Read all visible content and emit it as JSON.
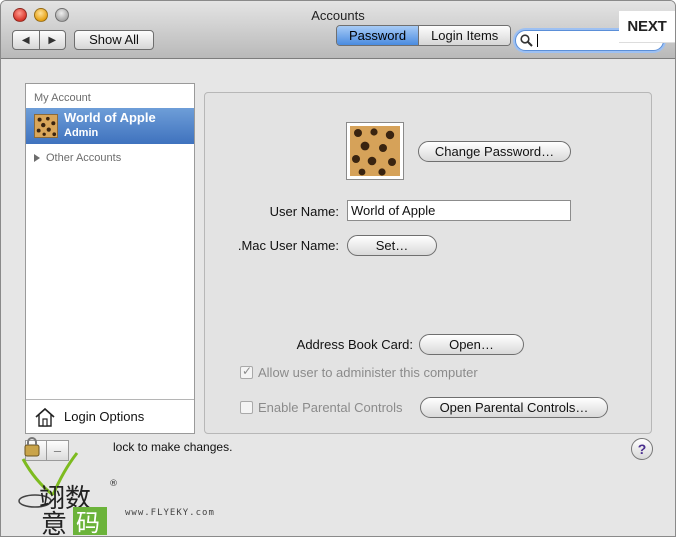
{
  "window": {
    "title": "Accounts"
  },
  "toolbar": {
    "back_label": "◀",
    "forward_label": "▶",
    "show_all_label": "Show All",
    "search_value": ""
  },
  "sidebar": {
    "my_account_header": "My Account",
    "selected_account": {
      "name": "World of Apple",
      "role": "Admin"
    },
    "other_accounts_label": "Other Accounts",
    "login_options_label": "Login Options",
    "add_label": "+",
    "remove_label": "–"
  },
  "tabs": [
    {
      "label": "Password",
      "active": true
    },
    {
      "label": "Login Items",
      "active": false
    }
  ],
  "next_label": "NEXT",
  "password_pane": {
    "change_password_label": "Change Password…",
    "user_name_label": "User Name:",
    "user_name_value": "World of Apple",
    "mac_user_name_label": ".Mac User Name:",
    "set_label": "Set…",
    "address_book_label": "Address Book Card:",
    "open_label": "Open…",
    "allow_admin_label": "Allow user to administer this computer",
    "allow_admin_checked": true,
    "parental_label": "Enable Parental Controls",
    "parental_checked": false,
    "open_parental_label": "Open Parental Controls…"
  },
  "footer": {
    "lock_text": "lock to make changes.",
    "help_label": "?"
  },
  "watermark": {
    "text": "翊数意码",
    "url_text": "www.FLYEKY.com"
  },
  "colors": {
    "selection": "#3f72be",
    "tab_active": "#4a8be0",
    "focus_ring": "#9dc0f2"
  }
}
